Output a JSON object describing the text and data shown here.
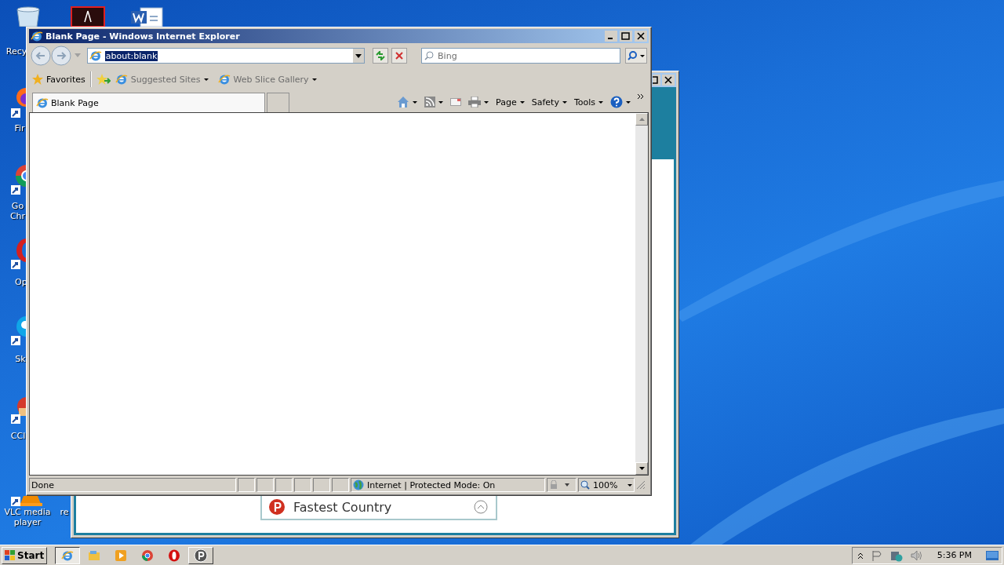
{
  "desktop_icons": [
    {
      "kind": "recycle",
      "label": "Recy"
    },
    {
      "kind": "pdf"
    },
    {
      "kind": "word"
    },
    {
      "kind": "firefox",
      "label": "Fir"
    },
    {
      "kind": "chrome",
      "label": "Go Chr"
    },
    {
      "kind": "opera",
      "label": "Op"
    },
    {
      "kind": "skype",
      "label": "Sk"
    },
    {
      "kind": "ccleaner",
      "label": "CCl"
    },
    {
      "kind": "vlc",
      "label": "VLC media player"
    },
    {
      "kind": "blank",
      "label": "re"
    }
  ],
  "background_window": {
    "dropdown": "Fastest Country"
  },
  "browser": {
    "title": "Blank Page - Windows Internet Explorer",
    "address": "about:blank",
    "address_selected": true,
    "search": {
      "placeholder": "Bing"
    },
    "favorites_bar": [
      {
        "kind": "favorites",
        "label": "Favorites"
      },
      {
        "kind": "link",
        "label": "Suggested Sites"
      },
      {
        "kind": "link",
        "label": "Web Slice Gallery"
      }
    ],
    "tabs": [
      {
        "label": "Blank Page",
        "selected": true
      }
    ],
    "command_bar": [
      "Page",
      "Safety",
      "Tools"
    ],
    "status_bar": {
      "text": "Done",
      "zone": "Internet | Protected Mode: On",
      "zoom": "100%"
    }
  },
  "taskbar": {
    "start": "Start",
    "apps": [
      {
        "kind": "ie",
        "selected": true
      },
      {
        "kind": "explorer",
        "selected": false
      },
      {
        "kind": "media",
        "selected": false
      },
      {
        "kind": "chrome",
        "selected": false
      },
      {
        "kind": "opera",
        "selected": false
      },
      {
        "kind": "psiphon",
        "selected": false
      }
    ],
    "clock": "5:36 PM"
  }
}
